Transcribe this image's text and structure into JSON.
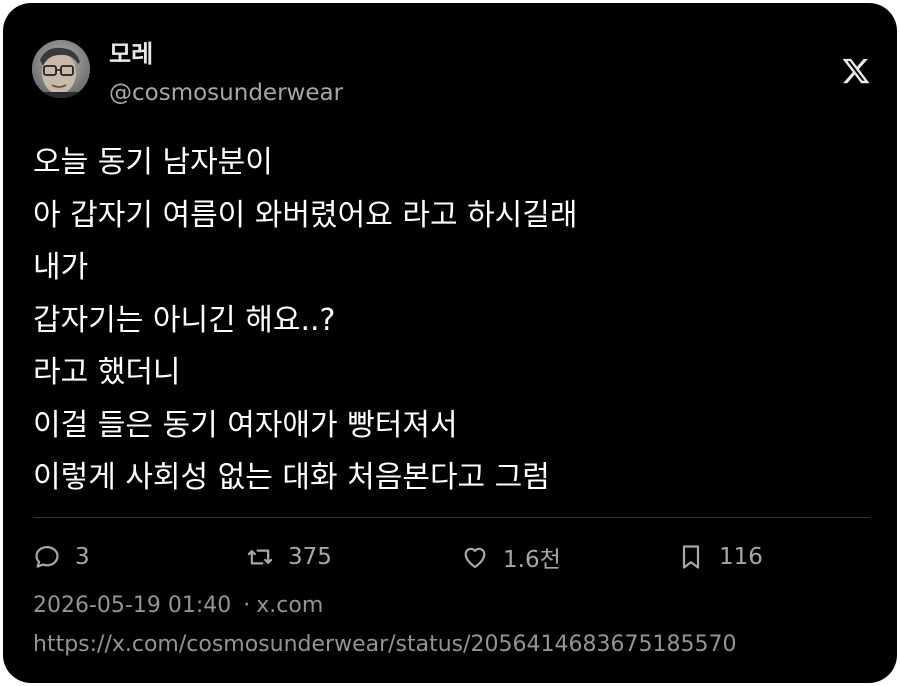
{
  "author": {
    "display_name": "모레",
    "handle": "@cosmosunderwear"
  },
  "tweet": {
    "lines": [
      "오늘 동기 남자분이",
      "아 갑자기 여름이 와버렸어요 라고 하시길래",
      "내가",
      "갑자기는 아니긴 해요..?",
      "라고 했더니",
      "이걸 들은 동기 여자애가 빵터져서",
      "이렇게 사회성 없는 대화 처음본다고 그럼"
    ]
  },
  "actions": {
    "replies": "3",
    "retweets": "375",
    "likes": "1.6천",
    "bookmarks": "116"
  },
  "meta": {
    "timestamp": "2026-05-19 01:40",
    "separator": "·",
    "source": "x.com",
    "url": "https://x.com/cosmosunderwear/status/2056414683675185570"
  },
  "icons": {
    "logo": "x-logo-icon",
    "reply": "speech-bubble-icon",
    "retweet": "retweet-icon",
    "like": "heart-icon",
    "bookmark": "bookmark-icon"
  },
  "colors": {
    "background": "#000000",
    "text": "#ffffff",
    "secondary_text": "#a3a8ad",
    "divider": "#2f3336"
  }
}
